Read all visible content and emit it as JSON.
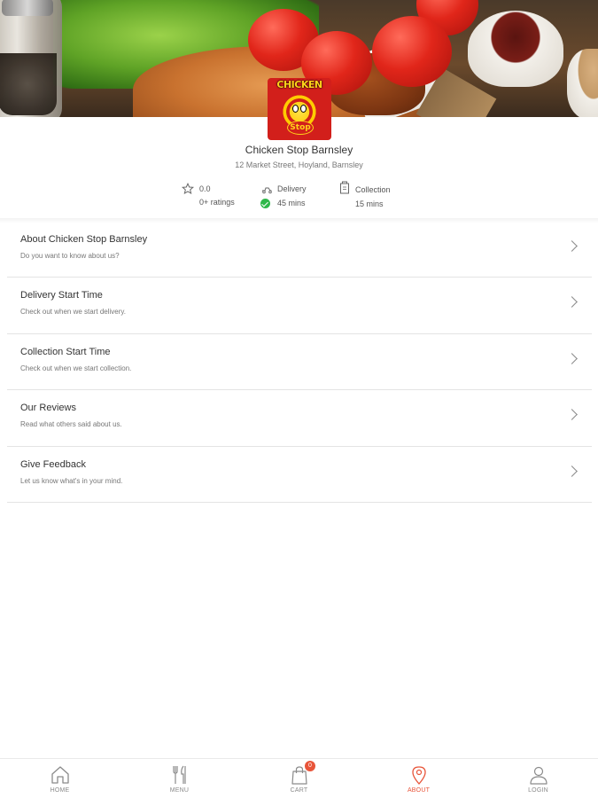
{
  "store": {
    "name": "Chicken Stop Barnsley",
    "address": "12 Market Street, Hoyland, Barnsley",
    "logo_text_top": "CHICKEN",
    "logo_text_bottom": "Stop"
  },
  "stats": {
    "rating_value": "0.0",
    "ratings_count": "0+ ratings",
    "delivery_label": "Delivery",
    "delivery_time": "45 mins",
    "collection_label": "Collection",
    "collection_time": "15 mins"
  },
  "menu_items": [
    {
      "title": "About Chicken Stop Barnsley",
      "subtitle": "Do you want to know about us?"
    },
    {
      "title": "Delivery Start Time",
      "subtitle": "Check out when we start delivery."
    },
    {
      "title": "Collection Start Time",
      "subtitle": "Check out when we start collection."
    },
    {
      "title": "Our Reviews",
      "subtitle": "Read what others said about us."
    },
    {
      "title": "Give Feedback",
      "subtitle": "Let us know what's in your mind."
    }
  ],
  "bottom_nav": {
    "home": "HOME",
    "menu": "MENU",
    "cart": "CART",
    "cart_count": "0",
    "about": "ABOUT",
    "login": "LOGIN"
  },
  "colors": {
    "accent": "#e8553a",
    "success": "#2fb84a",
    "logo_red": "#d21f1b",
    "logo_yellow": "#ffd21a"
  }
}
